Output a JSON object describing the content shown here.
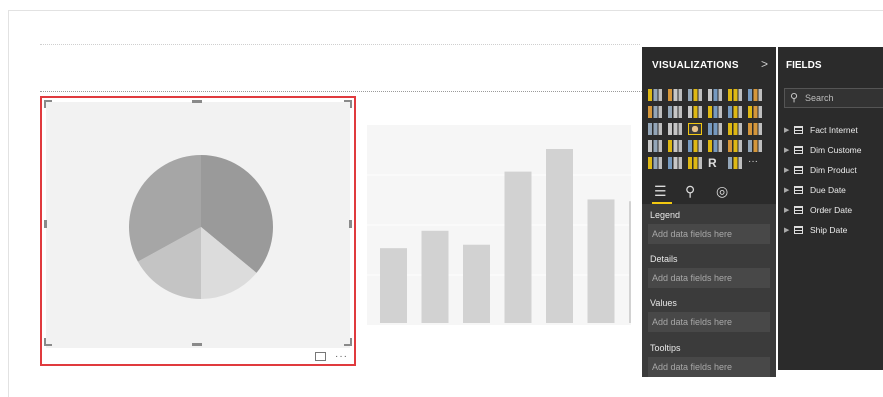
{
  "visualizations_pane": {
    "title": "VISUALIZATIONS",
    "collapse_glyph": ">",
    "tab_icons": [
      "fields-icon",
      "format-paint-icon",
      "analytics-icon"
    ],
    "wells": [
      {
        "label": "Legend",
        "placeholder": "Add data fields here"
      },
      {
        "label": "Details",
        "placeholder": "Add data fields here"
      },
      {
        "label": "Values",
        "placeholder": "Add data fields here"
      },
      {
        "label": "Tooltips",
        "placeholder": "Add data fields here"
      }
    ],
    "r_glyph": "R",
    "more_glyph": "···",
    "accent_color": "#f2c811"
  },
  "fields_pane": {
    "title": "FIELDS",
    "search_placeholder": "Search",
    "tables": [
      {
        "name": "Fact Internet"
      },
      {
        "name": "Dim Custome"
      },
      {
        "name": "Dim Product"
      },
      {
        "name": "Due Date"
      },
      {
        "name": "Order Date"
      },
      {
        "name": "Ship Date"
      }
    ]
  },
  "pie_visual": {
    "selected": true,
    "border_color": "#e03a3e",
    "more_glyph": "···",
    "slice_fractions": [
      0.36,
      0.14,
      0.17,
      0.33
    ],
    "slice_colors": [
      "#9a9a9a",
      "#dcdcdc",
      "#c4c4c4",
      "#a6a6a6"
    ]
  },
  "bar_visual": {
    "values": [
      0.43,
      0.53,
      0.45,
      0.87,
      1.0,
      0.71,
      0.7
    ],
    "bar_color": "#d2d2d2"
  }
}
